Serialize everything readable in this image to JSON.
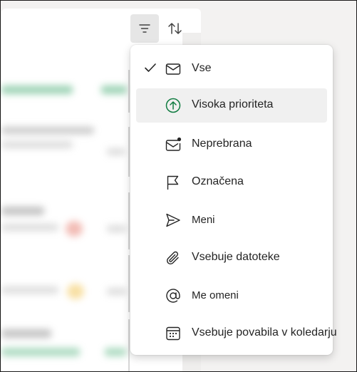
{
  "toolbar": {
    "filter_icon": "filter-lines-icon",
    "sort_icon": "sort-arrows-icon"
  },
  "filter_menu": {
    "selected_index": 0,
    "hovered_index": 1,
    "items": [
      {
        "label": "Vse",
        "icon": "mail-icon",
        "checked": true
      },
      {
        "label": "Visoka prioriteta",
        "icon": "arrow-up-circle-icon",
        "checked": false
      },
      {
        "label": "Neprebrana",
        "icon": "mail-unread-icon",
        "checked": false
      },
      {
        "label": "Označena",
        "icon": "flag-icon",
        "checked": false
      },
      {
        "label": "Meni",
        "icon": "send-icon",
        "checked": false
      },
      {
        "label": "Vsebuje datoteke",
        "icon": "attachment-icon",
        "checked": false
      },
      {
        "label": "Me omeni",
        "icon": "at-sign-icon",
        "checked": false
      },
      {
        "label": "Vsebuje povabila v koledarju",
        "icon": "calendar-icon",
        "checked": false
      }
    ]
  },
  "colors": {
    "accent_green": "#107c41",
    "menu_bg": "#ffffff",
    "hover_bg": "#f0f0f0",
    "text": "#242424"
  }
}
